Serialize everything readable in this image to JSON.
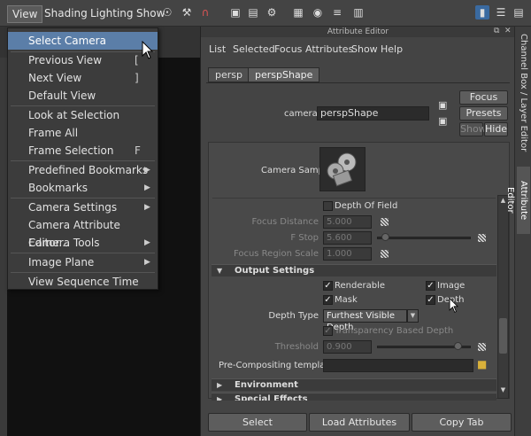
{
  "menubar": {
    "items": [
      {
        "label": "View",
        "active": true
      },
      {
        "label": "Shading",
        "active": false
      },
      {
        "label": "Lighting",
        "active": false
      },
      {
        "label": "Show",
        "active": false
      }
    ]
  },
  "toolbar": {
    "icons": [
      "magnet-icon",
      "wrench-icon",
      "magnet-tool-icon",
      "render-icon",
      "render-view-icon",
      "render-settings-icon",
      "layout-icon",
      "panel-icon",
      "hypershade-icon",
      "graph-icon",
      "script-icon",
      "outliner-icon"
    ]
  },
  "view_menu": {
    "items": [
      {
        "label": "Select Camera",
        "shortcut": "",
        "submenu": false,
        "highlighted": true
      },
      {
        "label": "Previous View",
        "shortcut": "[",
        "submenu": false
      },
      {
        "label": "Next View",
        "shortcut": "]",
        "submenu": false
      },
      {
        "label": "Default View",
        "shortcut": "",
        "submenu": false
      },
      {
        "label": "Look at Selection",
        "shortcut": "",
        "submenu": false
      },
      {
        "label": "Frame All",
        "shortcut": "",
        "submenu": false
      },
      {
        "label": "Frame Selection",
        "shortcut": "F",
        "submenu": false
      },
      {
        "label": "Predefined Bookmarks",
        "shortcut": "",
        "submenu": true
      },
      {
        "label": "Bookmarks",
        "shortcut": "",
        "submenu": true
      },
      {
        "label": "Camera Settings",
        "shortcut": "",
        "submenu": true
      },
      {
        "label": "Camera Attribute Editor...",
        "shortcut": "",
        "submenu": false
      },
      {
        "label": "Camera Tools",
        "shortcut": "",
        "submenu": true
      },
      {
        "label": "Image Plane",
        "shortcut": "",
        "submenu": true
      },
      {
        "label": "View Sequence Time",
        "shortcut": "",
        "submenu": false
      }
    ]
  },
  "attribute_editor": {
    "title": "Attribute Editor",
    "menu": [
      "List",
      "Selected",
      "Focus",
      "Attributes",
      "Show",
      "Help"
    ],
    "tabs": [
      {
        "label": "persp",
        "active": false
      },
      {
        "label": "perspShape",
        "active": true
      }
    ],
    "node_label": "camera:",
    "node_value": "perspShape",
    "buttons": {
      "focus": "Focus",
      "presets": "Presets",
      "show": "Show",
      "hide": "Hide"
    },
    "camera_sample_label": "Camera Sample",
    "dof": {
      "label": "Depth Of Field",
      "focus_distance_label": "Focus Distance",
      "focus_distance": "5.000",
      "fstop_label": "F Stop",
      "fstop": "5.600",
      "fstop_slider": 0.05,
      "focus_region_scale_label": "Focus Region Scale",
      "focus_region_scale": "1.000"
    },
    "output_settings": {
      "header": "Output Settings",
      "renderable": {
        "label": "Renderable",
        "checked": true
      },
      "image": {
        "label": "Image",
        "checked": true
      },
      "mask": {
        "label": "Mask",
        "checked": true
      },
      "depth": {
        "label": "Depth",
        "checked": true
      },
      "depth_type_label": "Depth Type",
      "depth_type_value": "Furthest Visible Depth",
      "transparency": {
        "label": "Transparency Based Depth",
        "checked": true
      },
      "threshold_label": "Threshold",
      "threshold": "0.900",
      "threshold_slider": 0.9,
      "precomp_label": "Pre-Compositing template",
      "precomp_value": ""
    },
    "sections_collapsed": [
      "Environment",
      "Special Effects"
    ],
    "bottom_buttons": [
      "Select",
      "Load Attributes",
      "Copy Tab"
    ]
  },
  "right_tabs": [
    "Channel Box / Layer Editor",
    "Attribute Editor"
  ],
  "colors": {
    "highlight": "#5b7ea8",
    "panel": "#444444",
    "field": "#2b2b2b"
  }
}
